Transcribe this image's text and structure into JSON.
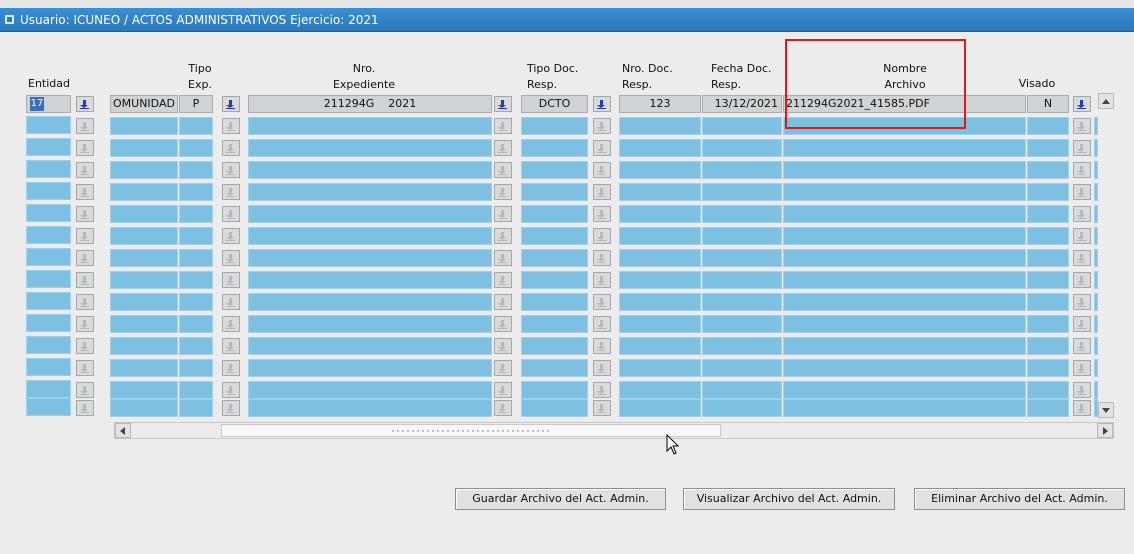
{
  "window": {
    "title": "Usuario: ICUNEO  /  ACTOS ADMINISTRATIVOS Ejercicio: 2021"
  },
  "headers": {
    "entidad": "Entidad",
    "tipo_exp_1": "Tipo",
    "tipo_exp_2": "Exp.",
    "nro_exp_1": "Nro.",
    "nro_exp_2": "Expediente",
    "tipo_doc_1": "Tipo Doc.",
    "tipo_doc_2": "Resp.",
    "nro_doc_1": "Nro. Doc.",
    "nro_doc_2": "Resp.",
    "fecha_doc_1": "Fecha Doc.",
    "fecha_doc_2": "Resp.",
    "nombre_arch_1": "Nombre",
    "nombre_arch_2": "Archivo",
    "visado": "Visado"
  },
  "entidad_value": "17",
  "record": {
    "comunidad": "OMUNIDAD",
    "tipo_exp": "P",
    "nro_expediente": "211294G    2021",
    "tipo_doc": "DCTO",
    "nro_doc": "123",
    "fecha_doc": "13/12/2021",
    "nombre_archivo": "211294G2021_41585.PDF",
    "visado": "N"
  },
  "actions": {
    "guardar": "Guardar Archivo del Act. Admin.",
    "visualizar": "Visualizar Archivo del Act. Admin.",
    "eliminar": "Eliminar Archivo del Act. Admin."
  },
  "colors": {
    "titlebar": "#2a78bc",
    "empty_field": "#7ec0e2",
    "current_field": "#cfd3d6",
    "highlight": "#e01818"
  },
  "icons": [
    "lov-download-icon",
    "scroll-up-icon",
    "scroll-down-icon",
    "scroll-left-icon",
    "scroll-right-icon",
    "mouse-cursor-icon"
  ]
}
